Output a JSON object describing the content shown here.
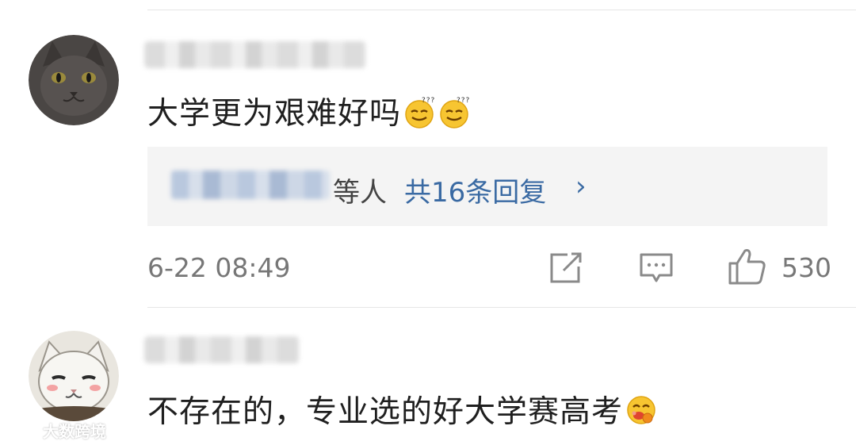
{
  "comments": [
    {
      "text": "大学更为艰难好吗",
      "emoji_names": [
        "dizzy-smile-emoji",
        "dizzy-smile-emoji"
      ],
      "replies": {
        "suffix": "等人",
        "count_label": "共16条回复",
        "chevron": "›"
      },
      "timestamp": "6-22 08:49",
      "like_count": "530"
    },
    {
      "text": "不存在的，专业选的好大学赛高考",
      "emoji_names": [
        "drooling-face-emoji"
      ]
    }
  ],
  "watermark": {
    "text": "大数跨境"
  },
  "colors": {
    "link": "#3a6aa3",
    "meta_text": "#777777",
    "reply_bg": "#f4f4f4"
  }
}
